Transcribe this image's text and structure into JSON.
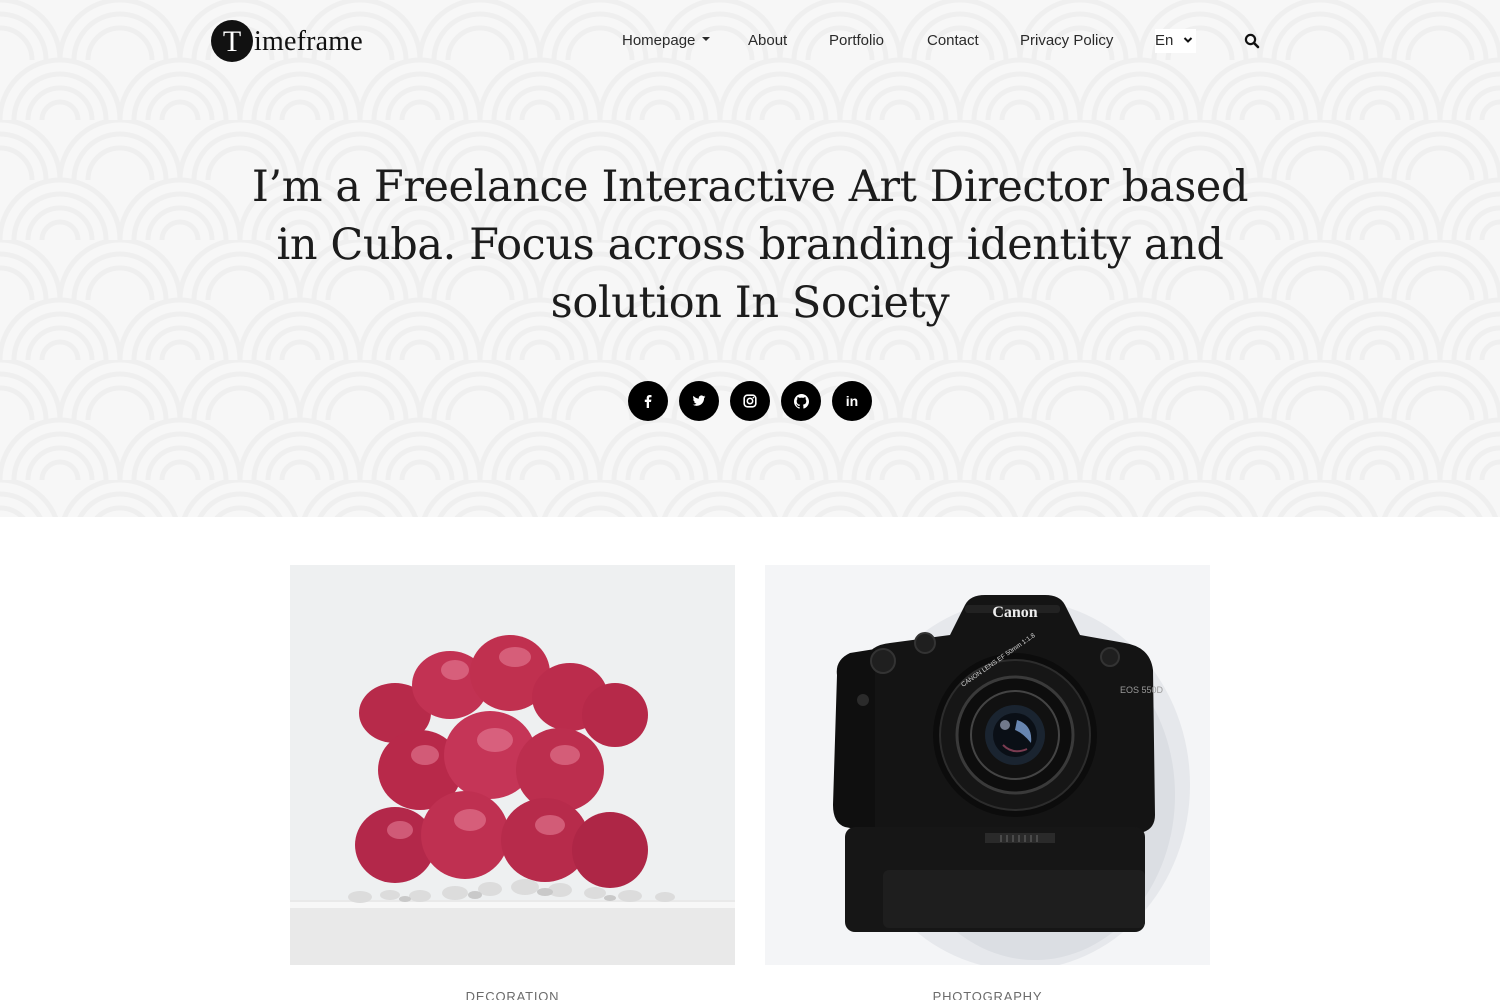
{
  "brand": {
    "logo_letter": "T",
    "logo_text": "imeframe"
  },
  "nav": {
    "items": [
      {
        "label": "Homepage",
        "has_dropdown": true
      },
      {
        "label": "About"
      },
      {
        "label": "Portfolio"
      },
      {
        "label": "Contact"
      },
      {
        "label": "Privacy Policy"
      }
    ],
    "language": "En",
    "search_icon": "search-icon"
  },
  "hero": {
    "title": "I’m a Freelance Interactive Art Director based in Cuba. Focus across branding identity and solution In Society",
    "socials": [
      {
        "icon": "facebook-icon"
      },
      {
        "icon": "twitter-icon"
      },
      {
        "icon": "instagram-icon"
      },
      {
        "icon": "github-icon"
      },
      {
        "icon": "linkedin-icon",
        "text": "in"
      }
    ]
  },
  "cards": [
    {
      "category": "DECORATION",
      "image": "red-cactus-in-white-pot"
    },
    {
      "category": "PHOTOGRAPHY",
      "image": "black-canon-camera-top-view",
      "brand_text": "Canon",
      "model_text": "EOS 550D"
    }
  ],
  "colors": {
    "hero_bg": "#f7f7f7",
    "text": "#1c1c1c",
    "social_bg": "#000000",
    "category_text": "#6b6b6b"
  }
}
